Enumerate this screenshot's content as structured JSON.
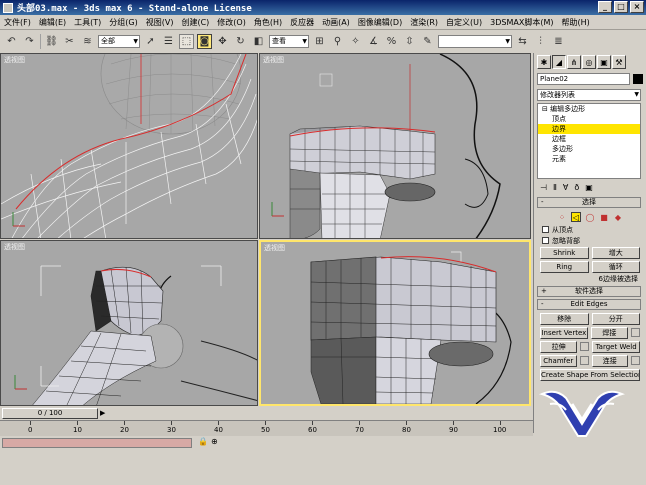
{
  "window": {
    "title": "头部03.max - 3ds max 6 - Stand-alone License",
    "buttons": [
      "_",
      "□",
      "×"
    ]
  },
  "menubar": [
    "文件(F)",
    "编辑(E)",
    "工具(T)",
    "分组(G)",
    "视图(V)",
    "创建(C)",
    "修改(O)",
    "角色(H)",
    "反应器",
    "动画(A)",
    "图像编辑(D)",
    "渲染(R)",
    "自定义(U)",
    "3DSMAX脚本(M)",
    "帮助(H)"
  ],
  "toolbar": {
    "selection_filter": "全部",
    "reference_coord": "查看",
    "named_selection": ""
  },
  "viewports": {
    "top_left": {
      "label": "透视图"
    },
    "top_right": {
      "label": "透视图"
    },
    "bottom_left": {
      "label": "透视图"
    },
    "bottom_right": {
      "label": "透视图"
    }
  },
  "command_panel": {
    "object_name": "Plane02",
    "object_color": "#000000",
    "modifier_list": "修改器列表",
    "stack": [
      {
        "label": "⊟ 编辑多边形",
        "level": 0,
        "selected": false
      },
      {
        "label": "顶点",
        "level": 1,
        "selected": false
      },
      {
        "label": "边界",
        "level": 1,
        "selected": true
      },
      {
        "label": "边框",
        "level": 1,
        "selected": false
      },
      {
        "label": "多边形",
        "level": 1,
        "selected": false
      },
      {
        "label": "元素",
        "level": 1,
        "selected": false
      }
    ],
    "selection_rollout": {
      "title": "选择",
      "sign": "-",
      "by_vertex": "从顶点",
      "ignore_backfacing": "忽略背部",
      "shrink": "Shrink",
      "grow": "增大",
      "ring": "Ring",
      "loop": "循环",
      "selected_count": "6边缘被选择"
    },
    "soft_selection": {
      "title": "软件选择",
      "sign": "+"
    },
    "edit_edges": {
      "title": "Edit Edges",
      "sign": "-",
      "remove": "移除",
      "split": "分开",
      "insert_vertex": "Insert Vertex",
      "weld": "焊接",
      "extrude": "拉伸",
      "target_weld": "Target Weld",
      "chamfer": "Chamfer",
      "connect": "连接",
      "create_shape": "Create Shape From Selection"
    }
  },
  "timeline": {
    "frame": "0 / 100",
    "ticks": [
      "0",
      "10",
      "20",
      "30",
      "40",
      "50",
      "60",
      "70",
      "80",
      "90",
      "100"
    ]
  },
  "colors": {
    "accent_selected": "#ffe500",
    "active_viewport": "#ffe66b",
    "viewport_bg": "#a7a7a7",
    "mesh_red": "#d92b2b"
  }
}
